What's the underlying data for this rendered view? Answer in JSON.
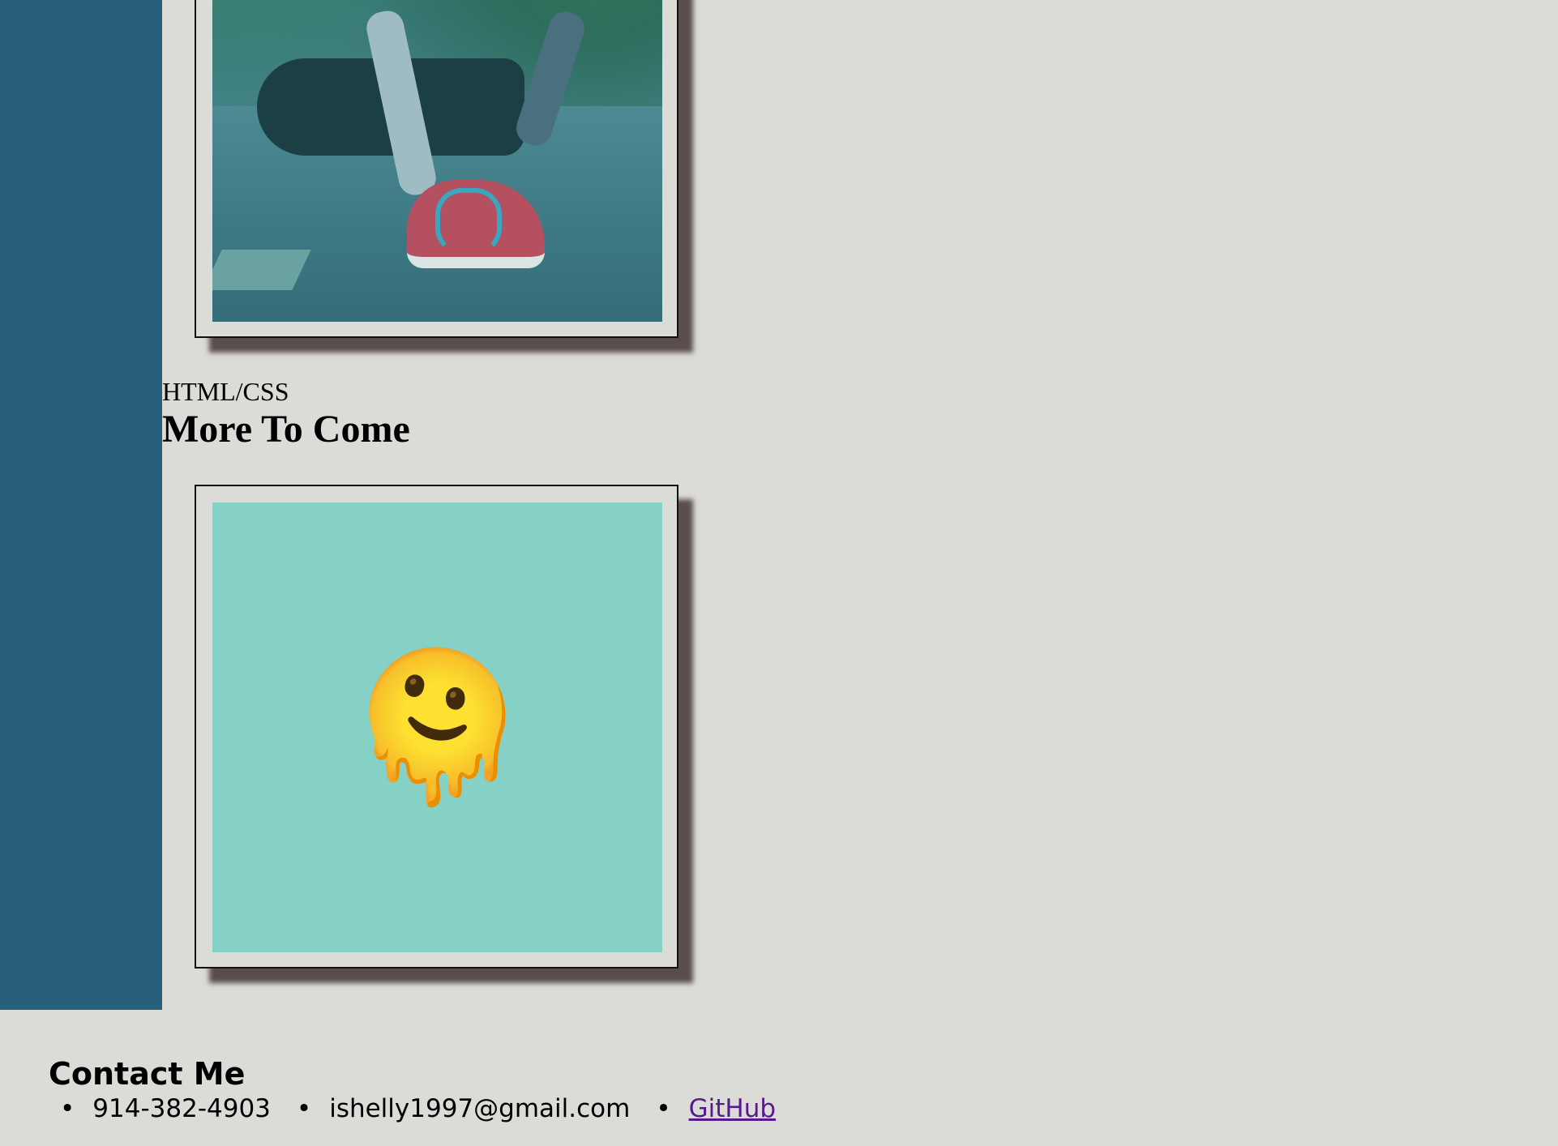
{
  "projects": [
    {
      "image_alt": "Person lacing running shoe"
    },
    {
      "label": "HTML/CSS",
      "title": "More To Come",
      "emoji": "🫠"
    }
  ],
  "footer": {
    "heading": "Contact Me",
    "phone": "914-382-4903",
    "email": "ishelly1997@gmail.com",
    "github": "GitHub"
  },
  "colors": {
    "background": "#dbdcd8",
    "sidebar": "#285f7a",
    "card_shadow": "#5a4d4e",
    "emoji_panel": "#86d1c6",
    "link_visited": "#551a8b"
  }
}
